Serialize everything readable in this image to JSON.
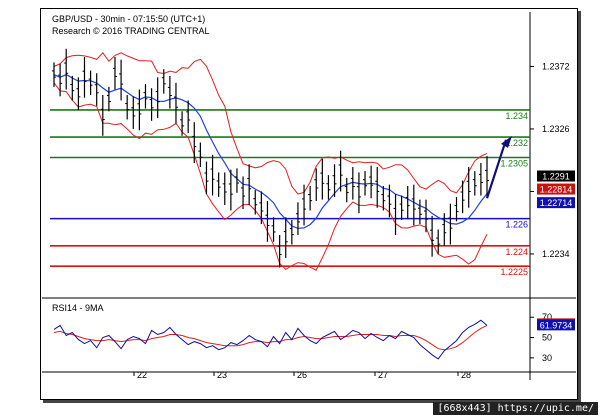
{
  "header": {
    "line1": "GBP/USD - 30min - 07:15:50 (UTC+1)",
    "line2": "Research © 2016 TRADING CENTRAL"
  },
  "watermark": "[668x443] https://upic.me/",
  "chart_data": {
    "type": "line",
    "price_axis": {
      "ticks": [
        1.2234,
        1.228,
        1.2326,
        1.2372
      ],
      "tick_labels": [
        "1.2234",
        "",
        "1.2326",
        "1.2372"
      ],
      "ylim": [
        1.2206,
        1.239
      ]
    },
    "x_labels": [
      "22",
      "23",
      "26",
      "27",
      "28"
    ],
    "levels": [
      {
        "label": "1.234",
        "value": 1.234,
        "color": "#1a7a1a"
      },
      {
        "label": "1.232",
        "value": 1.232,
        "color": "#1a7a1a"
      },
      {
        "label": "1.2305",
        "value": 1.2305,
        "color": "#1a7a1a"
      },
      {
        "label": "1.226",
        "value": 1.226,
        "color": "#1010c8"
      },
      {
        "label": "1.224",
        "value": 1.224,
        "color": "#e01010"
      },
      {
        "label": "1.2225",
        "value": 1.2225,
        "color": "#e01010"
      }
    ],
    "price_badges": [
      {
        "label": "1.2291",
        "value": 1.2291,
        "bg": "#000000"
      },
      {
        "label": "1.22814",
        "value": 1.22814,
        "bg": "#cc1010"
      },
      {
        "label": "1.22714",
        "value": 1.22714,
        "bg": "#1010b0"
      }
    ],
    "price_series": [
      1.2366,
      1.2362,
      1.237,
      1.2356,
      1.2352,
      1.2364,
      1.236,
      1.2355,
      1.2336,
      1.2348,
      1.2367,
      1.2362,
      1.2342,
      1.2338,
      1.234,
      1.235,
      1.2344,
      1.2349,
      1.2361,
      1.2353,
      1.2345,
      1.233,
      1.2335,
      1.2316,
      1.2307,
      1.229,
      1.2292,
      1.2285,
      1.2282,
      1.2281,
      1.2288,
      1.2279,
      1.2285,
      1.2272,
      1.2268,
      1.2258,
      1.2252,
      1.2236,
      1.2246,
      1.225,
      1.226,
      1.227,
      1.2275,
      1.2285,
      1.2289,
      1.2283,
      1.2288,
      1.2295,
      1.2281,
      1.2286,
      1.2279,
      1.2286,
      1.2287,
      1.2283,
      1.2275,
      1.2273,
      1.2263,
      1.2268,
      1.2272,
      1.227,
      1.2265,
      1.2262,
      1.2247,
      1.2243,
      1.2252,
      1.2256,
      1.2267,
      1.2276,
      1.2283,
      1.2286,
      1.2289,
      1.2291
    ],
    "projection": {
      "from": 1.2275,
      "to": 1.2318
    },
    "rsi": {
      "label": "RSI14 - 9MA",
      "tick_labels": [
        "70",
        "50",
        "30"
      ],
      "ticks": [
        70,
        50,
        30
      ],
      "ylim": [
        20,
        85
      ],
      "badges": [
        {
          "label": "62.9581",
          "value": 62.9581,
          "bg": "#cc1010"
        },
        {
          "label": "61.9734",
          "value": 61.9734,
          "bg": "#1010b0"
        }
      ],
      "rsi_series": [
        58,
        62,
        52,
        55,
        48,
        44,
        47,
        40,
        50,
        52,
        46,
        39,
        48,
        51,
        49,
        44,
        57,
        53,
        55,
        60,
        53,
        48,
        43,
        46,
        44,
        40,
        42,
        38,
        40,
        45,
        43,
        47,
        52,
        48,
        46,
        41,
        51,
        44,
        55,
        48,
        59,
        52,
        47,
        44,
        50,
        53,
        56,
        48,
        52,
        57,
        55,
        49,
        54,
        50,
        47,
        52,
        49,
        56,
        53,
        50,
        43,
        38,
        33,
        29,
        37,
        42,
        47,
        55,
        60,
        63,
        67,
        62
      ],
      "ma_series": [
        55,
        56,
        54,
        53,
        51,
        49,
        48,
        47,
        47,
        48,
        47,
        46,
        47,
        48,
        48,
        47,
        49,
        50,
        51,
        53,
        53,
        52,
        50,
        49,
        47,
        45,
        44,
        43,
        42,
        42,
        42,
        43,
        45,
        46,
        46,
        45,
        46,
        46,
        48,
        48,
        50,
        51,
        50,
        49,
        49,
        50,
        51,
        51,
        51,
        52,
        53,
        53,
        53,
        53,
        52,
        52,
        51,
        52,
        52,
        52,
        50,
        47,
        43,
        39,
        38,
        39,
        41,
        45,
        50,
        55,
        59,
        62
      ]
    }
  }
}
